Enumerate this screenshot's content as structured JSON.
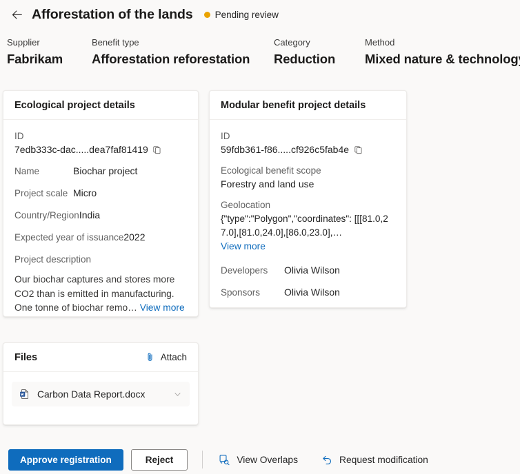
{
  "header": {
    "back_icon": "arrow-left-icon",
    "title": "Afforestation of the lands",
    "status_label": "Pending review",
    "status_color": "#eaa300"
  },
  "summary": {
    "fields": [
      {
        "label": "Supplier",
        "value": "Fabrikam"
      },
      {
        "label": "Benefit type",
        "value": "Afforestation reforestation"
      },
      {
        "label": "Category",
        "value": "Reduction"
      },
      {
        "label": "Method",
        "value": "Mixed nature & technology"
      }
    ]
  },
  "ecological_card": {
    "title": "Ecological project details",
    "id_label": "ID",
    "id_value": "7edb333c-dac.....dea7faf81419",
    "copy_icon": "copy-icon",
    "name_label": "Name",
    "name_value": "Biochar project",
    "scale_label": "Project scale",
    "scale_value": "Micro",
    "country_label": "Country/Region",
    "country_value": "India",
    "issuance_label": "Expected year of issuance",
    "issuance_value": "2022",
    "description_label": "Project description",
    "description_text": "Our biochar captures and stores more CO2 than is emitted in manufacturing. One tonne of biochar remo…",
    "view_more_label": "View more"
  },
  "modular_card": {
    "title": "Modular benefit project details",
    "id_label": "ID",
    "id_value": "59fdb361-f86.....cf926c5fab4e",
    "copy_icon": "copy-icon",
    "scope_label": "Ecological benefit scope",
    "scope_value": "Forestry and land use",
    "geolocation_label": "Geolocation",
    "geolocation_value": "{\"type\":\"Polygon\",\"coordinates\": [[[81.0,27.0],[81.0,24.0],[86.0,23.0],…",
    "view_more_label": "View more",
    "developers_label": "Developers",
    "developers_value": "Olivia Wilson",
    "sponsors_label": "Sponsors",
    "sponsors_value": "Olivia Wilson"
  },
  "files_card": {
    "title": "Files",
    "attach_label": "Attach",
    "attach_icon": "paperclip-icon",
    "items": [
      {
        "name": "Carbon Data Report.docx",
        "file_icon": "word-document-icon",
        "chevron_icon": "chevron-down-icon"
      }
    ]
  },
  "action_bar": {
    "approve_label": "Approve registration",
    "reject_label": "Reject",
    "view_overlaps_label": "View Overlaps",
    "view_overlaps_icon": "overlap-search-icon",
    "request_modification_label": "Request modification",
    "request_modification_icon": "arrow-undo-icon",
    "primary_color": "#0f6cbd"
  }
}
